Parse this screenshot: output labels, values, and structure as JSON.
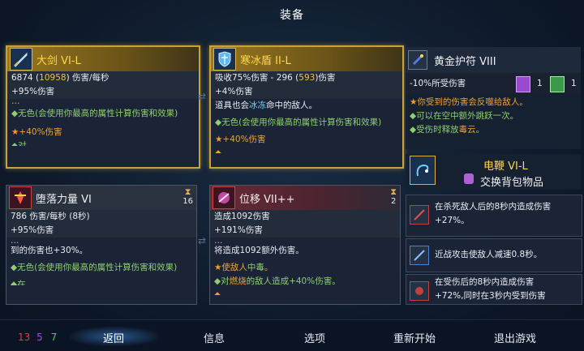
{
  "title": "装备",
  "cards": {
    "sword": {
      "name": "大剑 VI-L",
      "stat_a": "6874 (",
      "stat_b": "10958",
      "stat_c": ") 伤害/每秒",
      "dmg": "+95%伤害",
      "line1_frag": "…",
      "line2": "◆无色(会使用你最高的属性计算伤害和效果)",
      "line3": "★+40%伤害",
      "line4_frag": "◆对…"
    },
    "shield": {
      "name": "寒冰盾 II-L",
      "stat_a": "吸收75%伤害 - 296 (",
      "stat_b": "593",
      "stat_c": ")伤害",
      "dmg": "+4%伤害",
      "line1": "道具也会",
      "line1_hl": "冰冻",
      "line1_end": "命中的敌人。",
      "line2": "◆无色(会使用你最高的属性计算伤害和效果)",
      "line3": "★+40%伤害",
      "line4_frag": "◆…"
    },
    "fall": {
      "name": "堕落力量 VI",
      "count": "16",
      "stat": "786 伤害/每秒 (8秒)",
      "dmg": "+95%伤害",
      "line1": "到的伤害也+30%。",
      "line2": "◆无色(会使用你最高的属性计算伤害和效果)",
      "line3_frag": "◆在…"
    },
    "shift": {
      "name": "位移 VII++",
      "count": "2",
      "stat": "造成1092伤害",
      "dmg": "+191%伤害",
      "line1": "将造成1092额外伤害。",
      "line2_a": "★使敌人",
      "line2_b": "中毒",
      "line2_c": "。",
      "line3_a": "◆对",
      "line3_b": "燃烧",
      "line3_c": "的敌人造成+40%伤害。",
      "line4_frag": "◆…"
    }
  },
  "amulet": {
    "name": "黄金护符 VIII",
    "stat": "-10%所受伤害",
    "badge1": "1",
    "badge2": "1",
    "line1": "★你受到的伤害会反噬给敌人。",
    "line2": "◆可以在空中额外跳跃一次。",
    "line3_a": "◆受伤时释放",
    "line3_b": "毒云",
    "line3_c": "。"
  },
  "whip": {
    "name": "电鞭 VI-L",
    "swap": "交换背包物品"
  },
  "perks": [
    {
      "text1": "在杀死敌人后的8秒内造成伤害",
      "text2": "+27%。"
    },
    {
      "text1": "近战攻击使敌人减速0.8秒。",
      "text2": ""
    },
    {
      "text1": "在受伤后的8秒内造成伤害",
      "text2": "+72%,同时在3秒内受到伤害"
    }
  ],
  "scrolls": {
    "brutality": "13",
    "tactics": "5",
    "survival": "7"
  },
  "menu": {
    "back": "返回",
    "info": "信息",
    "options": "选项",
    "restart": "重新开始",
    "quit": "退出游戏"
  },
  "colors": {
    "brutality": "#e03a3a",
    "tactics": "#a050e0",
    "survival": "#4ad04a"
  }
}
